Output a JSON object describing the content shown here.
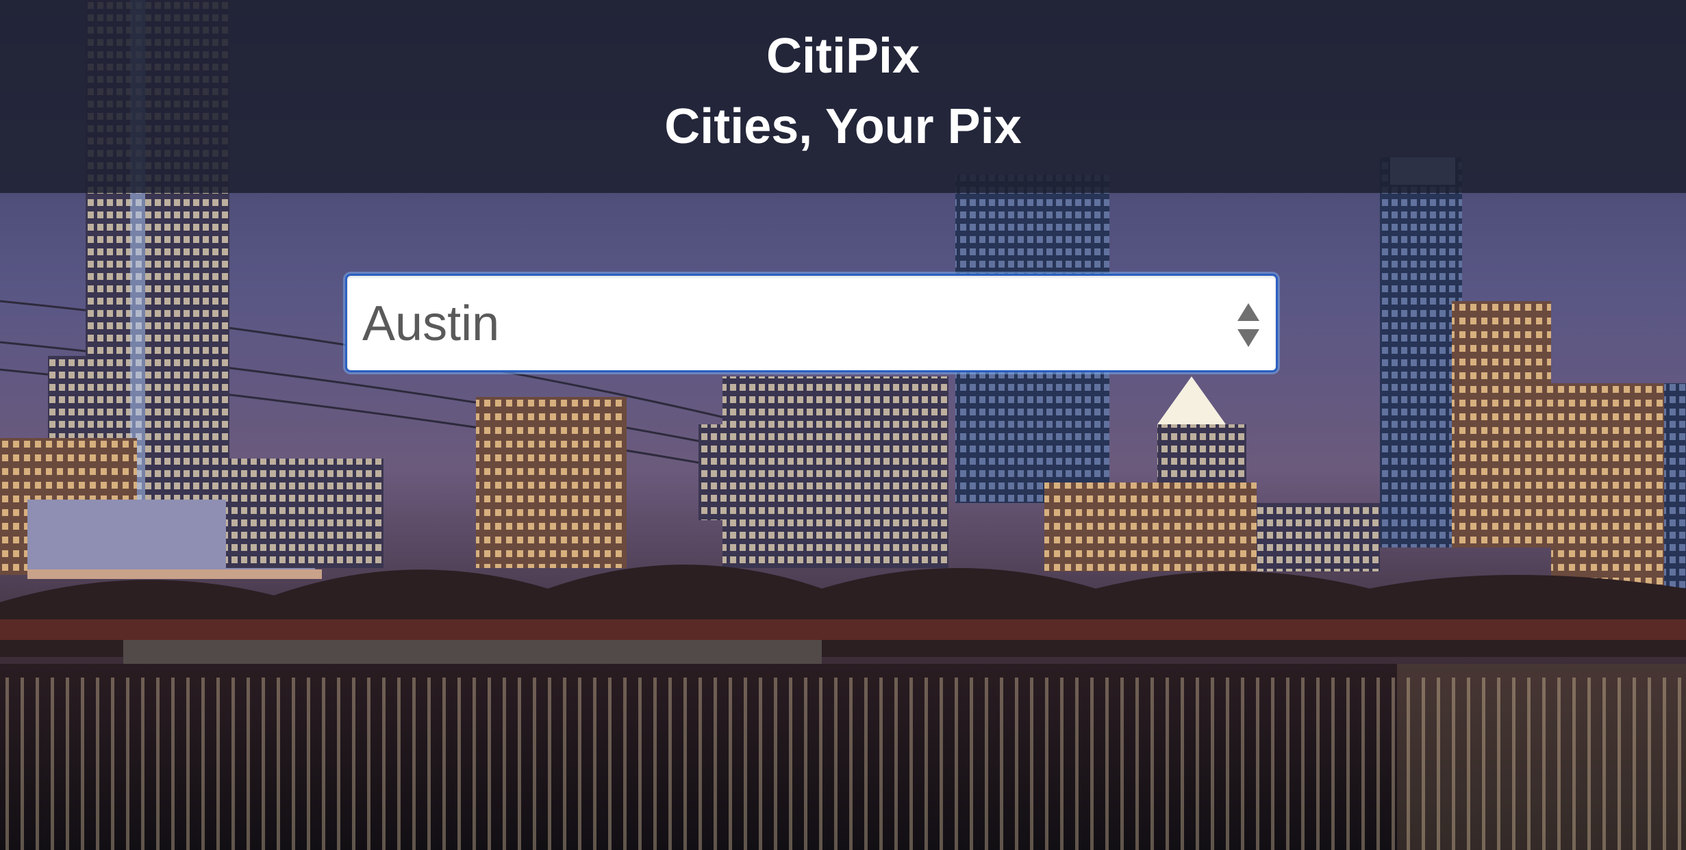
{
  "header": {
    "title": "CitiPix",
    "tagline": "Cities, Your Pix"
  },
  "city_select": {
    "selected": "Austin"
  },
  "background": {
    "description_icon": "city-skyline-image"
  }
}
